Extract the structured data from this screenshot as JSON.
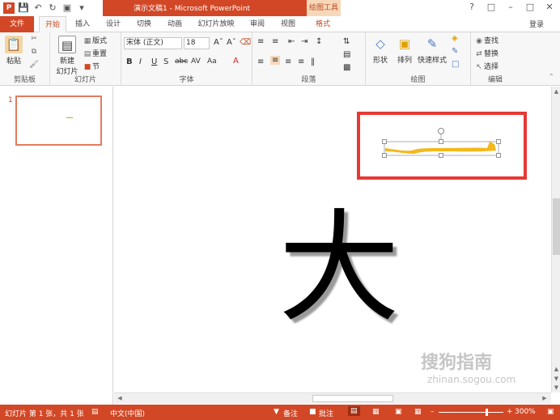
{
  "window": {
    "title": "演示文稿1 - Microsoft PowerPoint",
    "contextual_tab_group": "绘图工具",
    "login": "登录"
  },
  "tabs": [
    {
      "label": "文件"
    },
    {
      "label": "开始"
    },
    {
      "label": "插入"
    },
    {
      "label": "设计"
    },
    {
      "label": "切换"
    },
    {
      "label": "动画"
    },
    {
      "label": "幻灯片放映"
    },
    {
      "label": "审阅"
    },
    {
      "label": "视图"
    },
    {
      "label": "格式"
    }
  ],
  "active_tab": "开始",
  "ribbon": {
    "clipboard": {
      "label": "剪贴板",
      "paste": "粘贴"
    },
    "slides": {
      "label": "幻灯片",
      "new_slide_line1": "新建",
      "new_slide_line2": "幻灯片",
      "layout": "版式",
      "reset": "重置",
      "section": "节"
    },
    "font": {
      "label": "字体",
      "font_name": "宋体 (正文)",
      "font_size": "18",
      "bold": "B",
      "italic": "I",
      "underline": "U",
      "shadow": "S",
      "strike": "abc",
      "spacing": "AV",
      "case": "Aa"
    },
    "paragraph": {
      "label": "段落"
    },
    "drawing": {
      "label": "绘图",
      "shapes": "形状",
      "arrange": "排列",
      "quick_styles": "快速样式"
    },
    "editing": {
      "label": "编辑",
      "find": "查找",
      "replace": "替换",
      "select": "选择"
    }
  },
  "slide_panel": {
    "slide_number": "1"
  },
  "slide": {
    "big_character": "大"
  },
  "watermark": {
    "line1": "搜狗指南",
    "line2": "zhinan.sogou.com"
  },
  "status": {
    "slide_info": "幻灯片 第 1 张，共 1 张",
    "language": "中文(中国)",
    "notes": "备注",
    "comments": "批注",
    "zoom": "300%"
  },
  "colors": {
    "accent": "#d24726",
    "highlight": "#e53935",
    "stroke": "#f4b81c"
  }
}
